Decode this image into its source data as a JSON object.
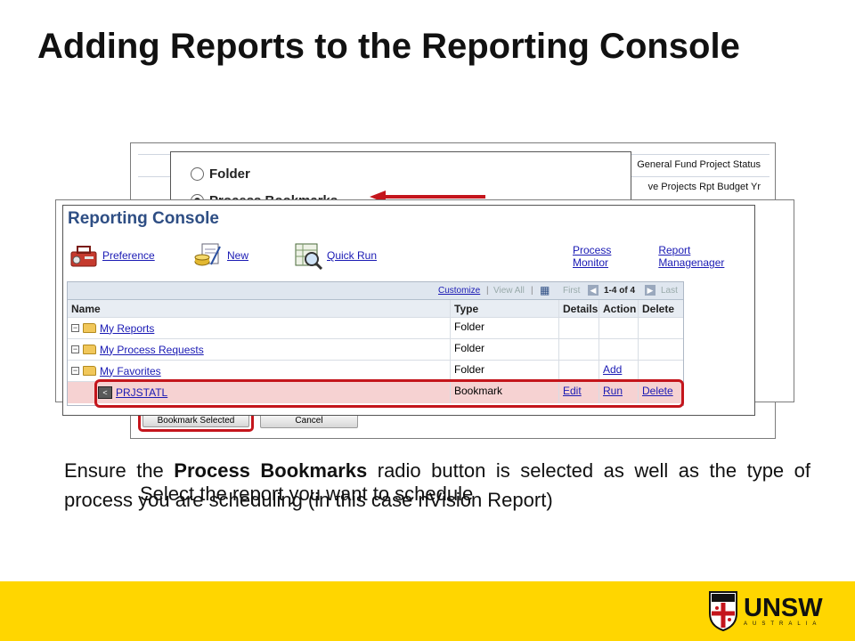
{
  "slide": {
    "title": "Adding Reports to the Reporting Console",
    "body_text_prefix": "Ensure the ",
    "body_text_bold": "Process Bookmarks",
    "body_text_suffix": " radio button is selected as well as the type of process you are scheduling (in this case nVision Report)",
    "overlay_caption": "Select the report you want to schedule"
  },
  "back_screen": {
    "rows": [
      "General Fund Project Status",
      "ve Projects Rpt Budget Yr"
    ],
    "bookmark_selected_label": "Bookmark Selected",
    "cancel_label": "Cancel"
  },
  "popup": {
    "options": [
      {
        "label": "Folder",
        "selected": false
      },
      {
        "label": "Process Bookmarks",
        "selected": true
      }
    ]
  },
  "console": {
    "title": "Reporting Console",
    "toolbar": {
      "preference": "Preference",
      "new": "New",
      "quick_run": "Quick Run",
      "process_monitor": "Process Monitor",
      "report_manager": "Report Managenager"
    },
    "grid_nav": {
      "customize": "Customize",
      "view_all": "View All",
      "first": "First",
      "range": "1-4 of 4",
      "last": "Last",
      "separator": "|"
    },
    "columns": [
      "Name",
      "Type",
      "Details",
      "Action",
      "Delete"
    ],
    "rows": [
      {
        "name": "My Reports",
        "type": "Folder",
        "details": "",
        "action": "",
        "delete": ""
      },
      {
        "name": "My Process Requests",
        "type": "Folder",
        "details": "",
        "action": "",
        "delete": ""
      },
      {
        "name": "My Favorites",
        "type": "Folder",
        "details": "",
        "action": "Add",
        "delete": ""
      },
      {
        "name": "PRJSTATL",
        "type": "Bookmark",
        "details": "Edit",
        "action": "Run",
        "delete": "Delete"
      }
    ]
  },
  "branding": {
    "logo_text": "UNSW",
    "logo_subtext": "AUSTRALIA",
    "footer_color": "#ffd600",
    "highlight_color": "#c4151c"
  }
}
